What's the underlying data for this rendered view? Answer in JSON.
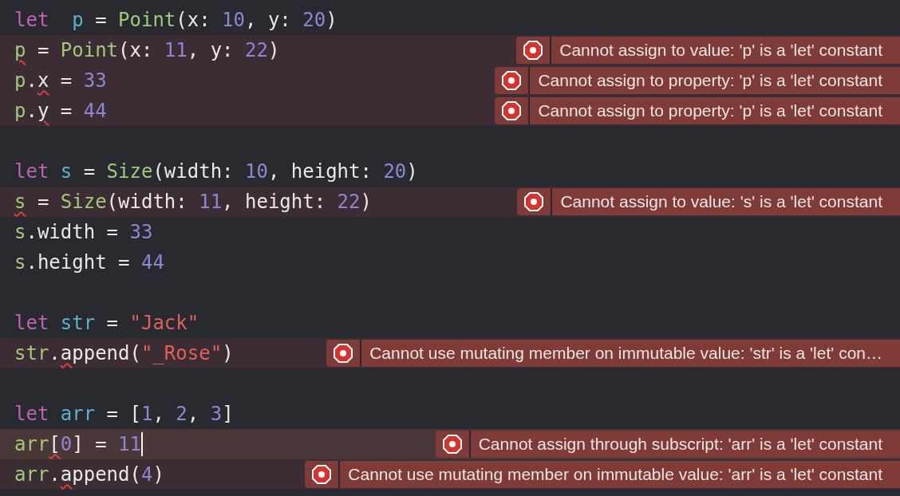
{
  "editor": {
    "lines": [
      {
        "kind": "code",
        "highlighted": false,
        "tokens": [
          {
            "kind": "keyword",
            "text": "let  "
          },
          {
            "kind": "decl",
            "text": "p"
          },
          {
            "kind": "plain",
            "text": " = "
          },
          {
            "kind": "type",
            "text": "Point"
          },
          {
            "kind": "plain",
            "text": "(x: "
          },
          {
            "kind": "number",
            "text": "10"
          },
          {
            "kind": "plain",
            "text": ", y: "
          },
          {
            "kind": "number",
            "text": "20"
          },
          {
            "kind": "plain",
            "text": ")"
          }
        ]
      },
      {
        "kind": "code",
        "highlighted": true,
        "tokens": [
          {
            "kind": "ref",
            "text": "p",
            "error": true
          },
          {
            "kind": "plain",
            "text": " = "
          },
          {
            "kind": "type",
            "text": "Point"
          },
          {
            "kind": "plain",
            "text": "(x: "
          },
          {
            "kind": "number",
            "text": "11"
          },
          {
            "kind": "plain",
            "text": ", y: "
          },
          {
            "kind": "number",
            "text": "22"
          },
          {
            "kind": "plain",
            "text": ")"
          }
        ],
        "error": "Cannot assign to value: 'p' is a 'let' constant"
      },
      {
        "kind": "code",
        "highlighted": true,
        "tokens": [
          {
            "kind": "ref",
            "text": "p"
          },
          {
            "kind": "plain",
            "text": "."
          },
          {
            "kind": "plain",
            "text": "x",
            "error": true
          },
          {
            "kind": "plain",
            "text": " = "
          },
          {
            "kind": "number",
            "text": "33"
          }
        ],
        "error": "Cannot assign to property: 'p' is a 'let' constant"
      },
      {
        "kind": "code",
        "highlighted": true,
        "tokens": [
          {
            "kind": "ref",
            "text": "p"
          },
          {
            "kind": "plain",
            "text": "."
          },
          {
            "kind": "plain",
            "text": "y",
            "error": true
          },
          {
            "kind": "plain",
            "text": " = "
          },
          {
            "kind": "number",
            "text": "44"
          }
        ],
        "error": "Cannot assign to property: 'p' is a 'let' constant"
      },
      {
        "kind": "blank"
      },
      {
        "kind": "code",
        "highlighted": false,
        "tokens": [
          {
            "kind": "keyword",
            "text": "let "
          },
          {
            "kind": "decl",
            "text": "s"
          },
          {
            "kind": "plain",
            "text": " = "
          },
          {
            "kind": "type",
            "text": "Size"
          },
          {
            "kind": "plain",
            "text": "(width: "
          },
          {
            "kind": "number",
            "text": "10"
          },
          {
            "kind": "plain",
            "text": ", height: "
          },
          {
            "kind": "number",
            "text": "20"
          },
          {
            "kind": "plain",
            "text": ")"
          }
        ]
      },
      {
        "kind": "code",
        "highlighted": true,
        "tokens": [
          {
            "kind": "ref",
            "text": "s",
            "error": true
          },
          {
            "kind": "plain",
            "text": " = "
          },
          {
            "kind": "type",
            "text": "Size"
          },
          {
            "kind": "plain",
            "text": "(width: "
          },
          {
            "kind": "number",
            "text": "11"
          },
          {
            "kind": "plain",
            "text": ", height: "
          },
          {
            "kind": "number",
            "text": "22"
          },
          {
            "kind": "plain",
            "text": ")"
          }
        ],
        "error": "Cannot assign to value: 's' is a 'let' constant"
      },
      {
        "kind": "code",
        "highlighted": false,
        "tokens": [
          {
            "kind": "ref",
            "text": "s"
          },
          {
            "kind": "plain",
            "text": ".width = "
          },
          {
            "kind": "number",
            "text": "33"
          }
        ]
      },
      {
        "kind": "code",
        "highlighted": false,
        "tokens": [
          {
            "kind": "ref",
            "text": "s"
          },
          {
            "kind": "plain",
            "text": ".height = "
          },
          {
            "kind": "number",
            "text": "44"
          }
        ]
      },
      {
        "kind": "blank"
      },
      {
        "kind": "code",
        "highlighted": false,
        "tokens": [
          {
            "kind": "keyword",
            "text": "let "
          },
          {
            "kind": "decl",
            "text": "str"
          },
          {
            "kind": "plain",
            "text": " = "
          },
          {
            "kind": "string",
            "text": "\"Jack\""
          }
        ]
      },
      {
        "kind": "code",
        "highlighted": true,
        "tokens": [
          {
            "kind": "ref",
            "text": "str"
          },
          {
            "kind": "plain",
            "text": "."
          },
          {
            "kind": "plain",
            "text": "a",
            "error": true
          },
          {
            "kind": "plain",
            "text": "ppend("
          },
          {
            "kind": "string",
            "text": "\"_Rose\""
          },
          {
            "kind": "plain",
            "text": ")"
          }
        ],
        "error": "Cannot use mutating member on immutable value: 'str' is a 'let' con…"
      },
      {
        "kind": "blank"
      },
      {
        "kind": "code",
        "highlighted": false,
        "tokens": [
          {
            "kind": "keyword",
            "text": "let "
          },
          {
            "kind": "decl",
            "text": "arr"
          },
          {
            "kind": "plain",
            "text": " = ["
          },
          {
            "kind": "number",
            "text": "1"
          },
          {
            "kind": "plain",
            "text": ", "
          },
          {
            "kind": "number",
            "text": "2"
          },
          {
            "kind": "plain",
            "text": ", "
          },
          {
            "kind": "number",
            "text": "3"
          },
          {
            "kind": "plain",
            "text": "]"
          }
        ]
      },
      {
        "kind": "code",
        "highlighted": true,
        "current": true,
        "cursor": true,
        "tokens": [
          {
            "kind": "ref",
            "text": "arr"
          },
          {
            "kind": "plain",
            "text": "[",
            "error": true
          },
          {
            "kind": "number",
            "text": "0"
          },
          {
            "kind": "plain",
            "text": "] = "
          },
          {
            "kind": "number",
            "text": "11"
          }
        ],
        "error": "Cannot assign through subscript: 'arr' is a 'let' constant"
      },
      {
        "kind": "code",
        "highlighted": true,
        "tokens": [
          {
            "kind": "ref",
            "text": "arr"
          },
          {
            "kind": "plain",
            "text": "."
          },
          {
            "kind": "plain",
            "text": "a",
            "error": true
          },
          {
            "kind": "plain",
            "text": "ppend("
          },
          {
            "kind": "number",
            "text": "4"
          },
          {
            "kind": "plain",
            "text": ")"
          }
        ],
        "error": "Cannot use mutating member on immutable value: 'arr' is a 'let' constant"
      }
    ]
  }
}
